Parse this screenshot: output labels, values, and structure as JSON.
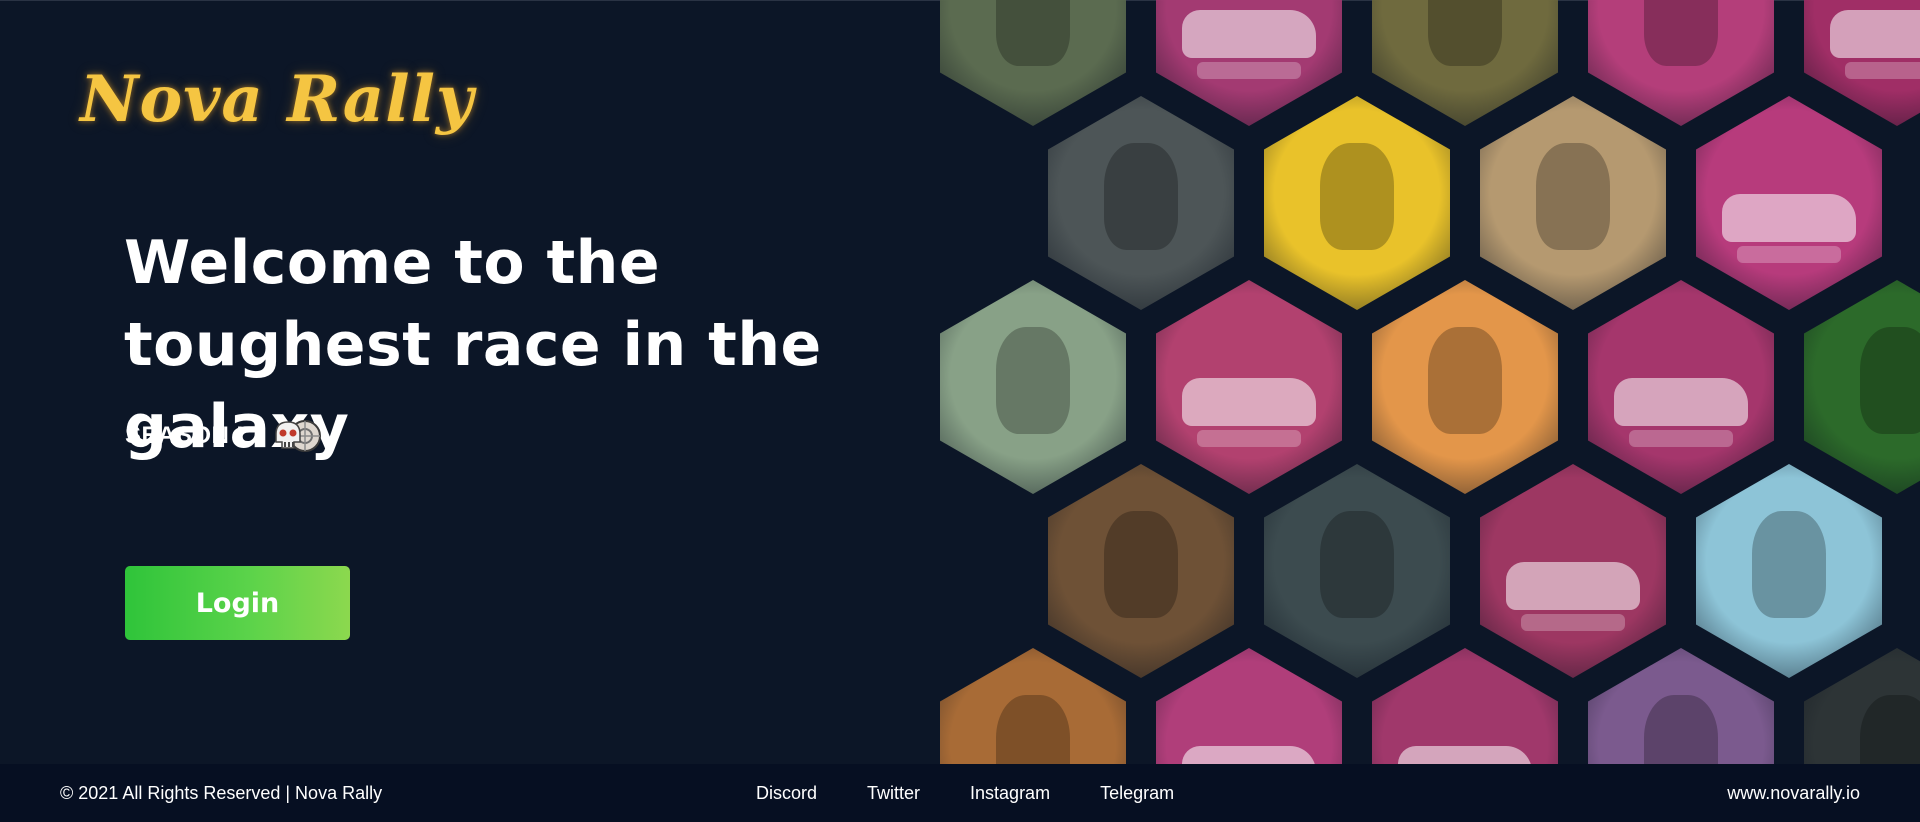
{
  "brand": {
    "logo_text": "Nova Rally"
  },
  "hero": {
    "headline": "Welcome to the toughest race in the galaxy",
    "season_label": "SEASON I",
    "season_icon": "skull-wheel-icon",
    "login_label": "Login",
    "accent_color": "#3cc93f"
  },
  "gallery": {
    "tiles": [
      {
        "color": "#5b6b50",
        "kind": "fig",
        "name": "gallery-tile-robot-red"
      },
      {
        "color": "#a33a72",
        "kind": "car",
        "name": "gallery-tile-car-teal"
      },
      {
        "color": "#6f6a3e",
        "kind": "fig",
        "name": "gallery-tile-alien-gold"
      },
      {
        "color": "#b43e7a",
        "kind": "fig",
        "name": "gallery-tile-alien-green"
      },
      {
        "color": "#a02e66",
        "kind": "car",
        "name": "gallery-tile-car-orange"
      },
      {
        "color": "#4d5557",
        "kind": "fig",
        "name": "gallery-tile-robot-black"
      },
      {
        "color": "#e9c22a",
        "kind": "fig",
        "name": "gallery-tile-ogre-blue"
      },
      {
        "color": "#b59970",
        "kind": "fig",
        "name": "gallery-tile-alien-astronaut"
      },
      {
        "color": "#b73b7c",
        "kind": "car",
        "name": "gallery-tile-car-yellow"
      },
      {
        "color": "#88a187",
        "kind": "fig",
        "name": "gallery-tile-robot-grey"
      },
      {
        "color": "#b2416f",
        "kind": "car",
        "name": "gallery-tile-van-blue"
      },
      {
        "color": "#e3964a",
        "kind": "fig",
        "name": "gallery-tile-alien-eye"
      },
      {
        "color": "#a5366c",
        "kind": "car",
        "name": "gallery-tile-car-silver"
      },
      {
        "color": "#2c6a2a",
        "kind": "fig",
        "name": "gallery-tile-monster-green"
      },
      {
        "color": "#6e5136",
        "kind": "fig",
        "name": "gallery-tile-dino-mech"
      },
      {
        "color": "#3c4b4f",
        "kind": "fig",
        "name": "gallery-tile-brute-red"
      },
      {
        "color": "#9d3762",
        "kind": "car",
        "name": "gallery-tile-car-green"
      },
      {
        "color": "#8dc4d7",
        "kind": "fig",
        "name": "gallery-tile-tree-creature"
      },
      {
        "color": "#a86b36",
        "kind": "fig",
        "name": "gallery-tile-skeleton-flame"
      },
      {
        "color": "#b03e7a",
        "kind": "car",
        "name": "gallery-tile-truck-white"
      },
      {
        "color": "#a0386b",
        "kind": "car",
        "name": "gallery-tile-car-red"
      },
      {
        "color": "#7b5a8e",
        "kind": "fig",
        "name": "gallery-tile-dancer"
      },
      {
        "color": "#2d3436",
        "kind": "fig",
        "name": "gallery-tile-robot-dark"
      }
    ]
  },
  "footer": {
    "copyright": "© 2021 All Rights Reserved | Nova Rally",
    "links": [
      "Discord",
      "Twitter",
      "Instagram",
      "Telegram"
    ],
    "site": "www.novarally.io"
  }
}
